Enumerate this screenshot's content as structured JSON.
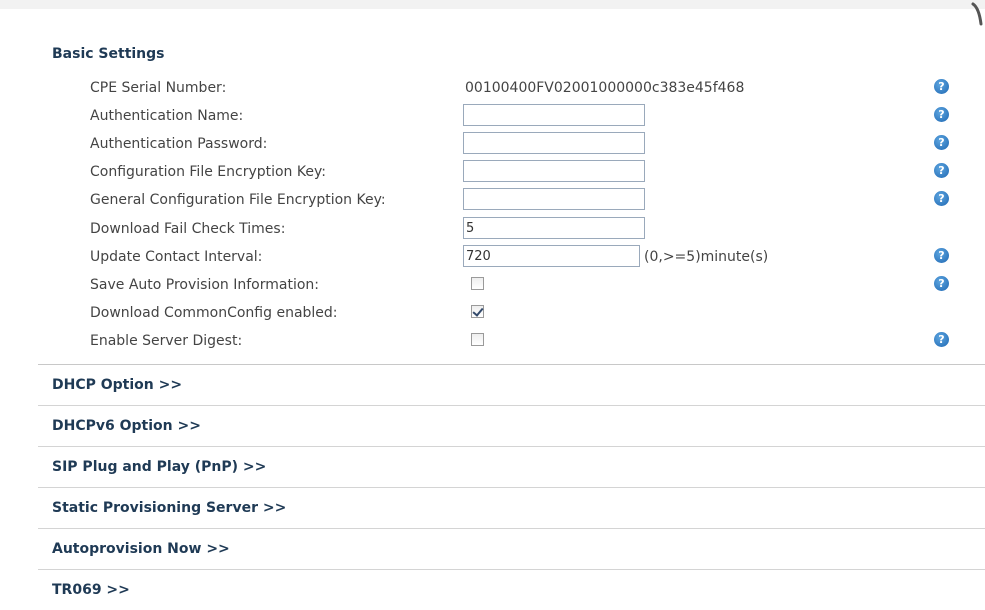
{
  "basic_settings": {
    "title": "Basic Settings",
    "cpe_serial": {
      "label": "CPE Serial Number:",
      "value": "00100400FV02001000000c383e45f468"
    },
    "auth_name": {
      "label": "Authentication Name:",
      "value": ""
    },
    "auth_password": {
      "label": "Authentication Password:",
      "value": ""
    },
    "config_key": {
      "label": "Configuration File Encryption Key:",
      "value": ""
    },
    "general_config_key": {
      "label": "General Configuration File Encryption Key:",
      "value": ""
    },
    "download_fail_check": {
      "label": "Download Fail Check Times:",
      "value": "5"
    },
    "update_interval": {
      "label": "Update Contact Interval:",
      "value": "720",
      "unit": "(0,>=5)minute(s)"
    },
    "save_auto_provision": {
      "label": "Save Auto Provision Information:",
      "checked": false
    },
    "download_commonconfig": {
      "label": "Download CommonConfig enabled:",
      "checked": true
    },
    "enable_server_digest": {
      "label": "Enable Server Digest:",
      "checked": false
    },
    "help_glyph": "?"
  },
  "sections": [
    {
      "label": "DHCP Option >>"
    },
    {
      "label": "DHCPv6 Option >>"
    },
    {
      "label": "SIP Plug and Play (PnP) >>"
    },
    {
      "label": "Static Provisioning Server >>"
    },
    {
      "label": "Autoprovision Now >>"
    },
    {
      "label": "TR069 >>"
    }
  ],
  "colors": {
    "heading": "#1f3a55",
    "help_icon": "#1e67b2",
    "input_border": "#9aa9bb"
  },
  "icons": {
    "help": "question-mark-circle-icon",
    "corner": "corner-curve-icon"
  }
}
